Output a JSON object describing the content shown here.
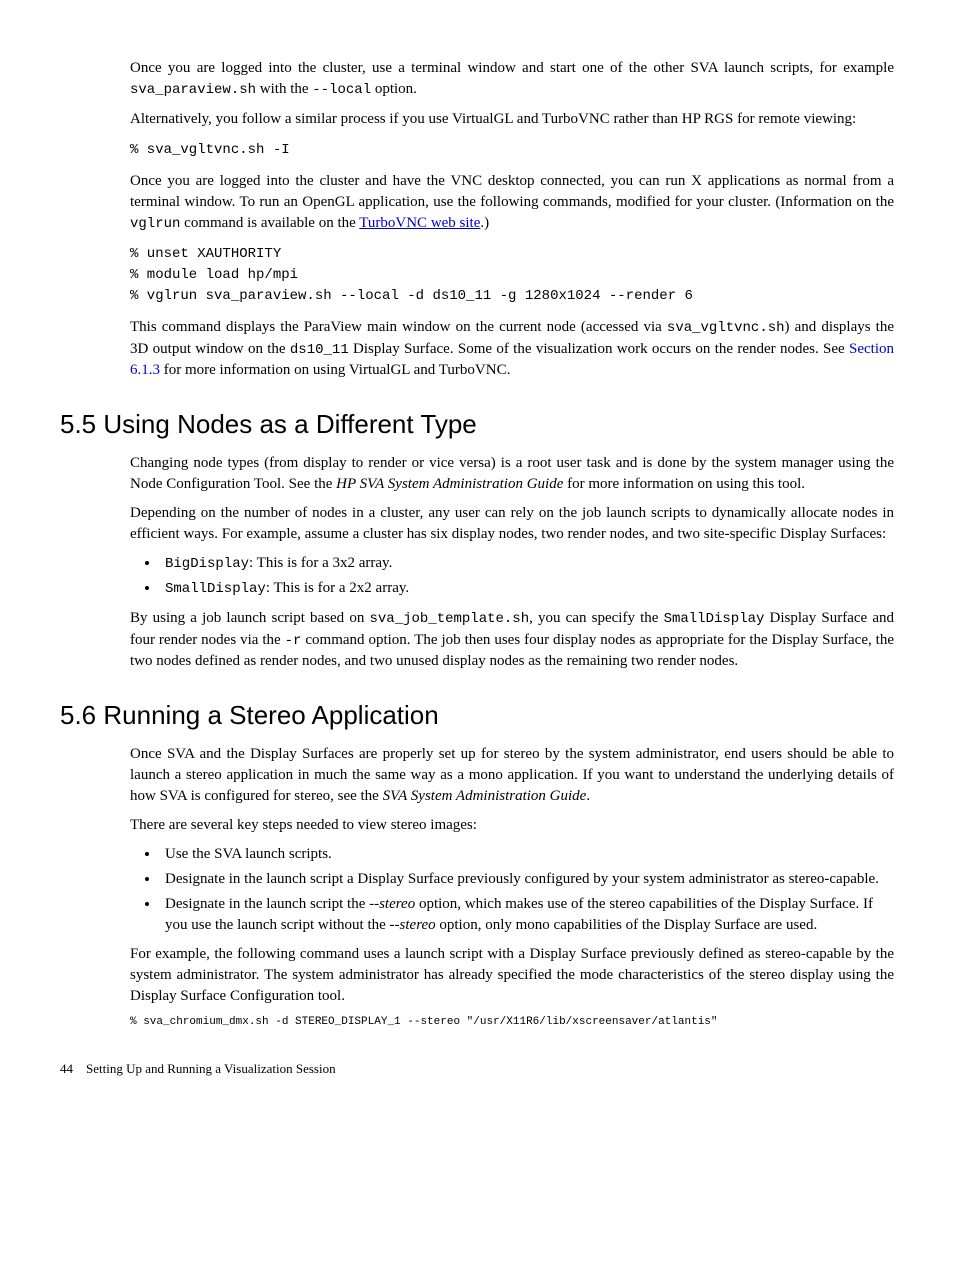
{
  "para1a": "Once you are logged into the cluster, use a terminal window and start one of the other SVA launch scripts, for example ",
  "para1b": " with the ",
  "para1c": " option.",
  "code_paraview": "sva_paraview.sh",
  "code_local": "--local",
  "para2": "Alternatively, you follow a similar process if you use VirtualGL and TurboVNC rather than HP RGS for remote viewing:",
  "codeblock1": "% sva_vgltvnc.sh -I",
  "para3a": "Once you are logged into the cluster and have the VNC desktop connected, you can run X applications as normal from a terminal window. To run an OpenGL application, use the following commands, modified for your cluster. (Information on the ",
  "code_vglrun": "vglrun",
  "para3b": " command is available on the ",
  "link_turbovnc": "TurboVNC web site",
  "para3c": ".)",
  "codeblock2": "% unset XAUTHORITY\n% module load hp/mpi\n% vglrun sva_paraview.sh --local -d ds10_11 -g 1280x1024 --render 6",
  "para4a": "This command displays the ParaView main window on the current node (accessed via ",
  "code_vgltvnc": "sva_vgltvnc.sh",
  "para4b": ") and displays the 3D output window on the ",
  "code_ds10": "ds10_11",
  "para4c": " Display Surface. Some of the visualization work occurs on the render nodes. See ",
  "xref_section": "Section 6.1.3",
  "para4d": " for more information on using VirtualGL and TurboVNC.",
  "h55_num": "5.5",
  "h55_title": " Using Nodes as a Different Type",
  "para55_1a": "Changing node types (from display to render or vice versa) is a root user task and is done by the system manager using the Node Configuration Tool. See the ",
  "italic_guide1": "HP SVA System Administration Guide",
  "para55_1b": " for more information on using this tool.",
  "para55_2": "Depending on the number of nodes in a cluster, any user can rely on the job launch scripts to dynamically allocate nodes in efficient ways. For example, assume a cluster has six display nodes, two render nodes, and two site-specific Display Surfaces:",
  "li_big_code": "BigDisplay",
  "li_big_text": ": This is for a 3x2 array.",
  "li_small_code": "SmallDisplay",
  "li_small_text": ": This is for a 2x2 array.",
  "para55_3a": "By using a job launch script based on ",
  "code_template": "sva_job_template.sh",
  "para55_3b": ", you can specify the ",
  "code_smalldisplay": "SmallDisplay",
  "para55_3c": " Display Surface and four render nodes via the ",
  "code_r": "-r",
  "para55_3d": " command option. The job then uses four display nodes as appropriate for the Display Surface, the two nodes defined as render nodes, and two unused display nodes as the remaining two render nodes.",
  "h56_num": "5.6",
  "h56_title": " Running a Stereo Application",
  "para56_1a": "Once SVA and the Display Surfaces are properly set up for stereo by the system administrator, end users should be able to launch a stereo application in much the same way as a mono application. If you want to understand the underlying details of how SVA is configured for stereo, see the ",
  "italic_guide2": "SVA System Administration Guide",
  "para56_1b": ".",
  "para56_2": "There are several key steps needed to view stereo images:",
  "li56_1": "Use the SVA launch scripts.",
  "li56_2": "Designate in the launch script a Display Surface previously configured by your system administrator as stereo-capable.",
  "li56_3a": "Designate in the launch script the ",
  "italic_stereo1": "--stereo",
  "li56_3b": " option, which makes use of the stereo capabilities of the Display Surface. If you use the launch script without the ",
  "italic_stereo2": "--stereo",
  "li56_3c": " option, only mono capabilities of the Display Surface are used.",
  "para56_3": "For example, the following command uses a launch script with a Display Surface previously defined as stereo-capable by the system administrator. The system administrator has already specified the mode characteristics of the stereo display using the Display Surface Configuration tool.",
  "codeblock3": "% sva_chromium_dmx.sh -d STEREO_DISPLAY_1 --stereo \"/usr/X11R6/lib/xscreensaver/atlantis\"",
  "footer_page": "44",
  "footer_text": "Setting Up and Running a Visualization Session"
}
